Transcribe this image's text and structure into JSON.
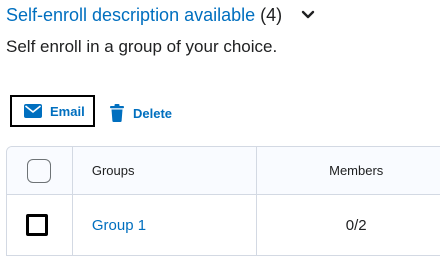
{
  "section": {
    "title": "Self-enroll description available",
    "count": "(4)",
    "description": "Self enroll in a group of your choice."
  },
  "toolbar": {
    "email_label": "Email",
    "delete_label": "Delete"
  },
  "table": {
    "headers": {
      "groups": "Groups",
      "members": "Members"
    },
    "rows": [
      {
        "group": "Group 1",
        "members": "0/2"
      }
    ]
  },
  "colors": {
    "link": "#006fbf",
    "text": "#202122",
    "border": "#d3d9e3"
  }
}
